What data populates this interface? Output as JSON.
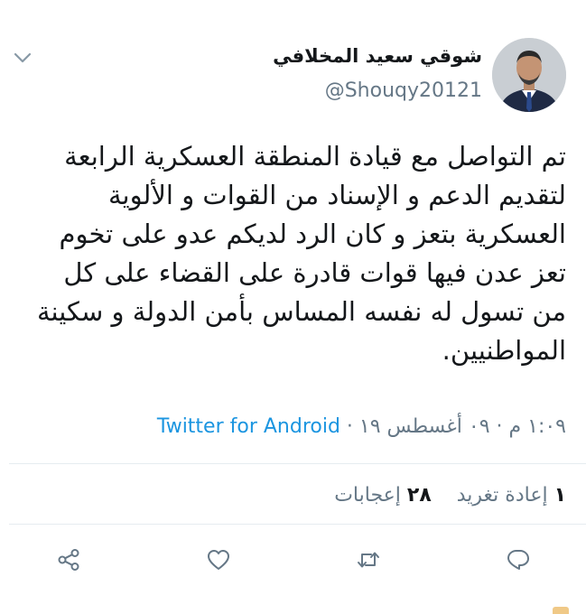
{
  "author": {
    "name": "شوقي سعيد المخلافي",
    "handle": "@Shouqy20121"
  },
  "tweet": {
    "text": "تم التواصل مع قيادة المنطقة العسكرية الرابعة لتقديم الدعم و الإسناد من القوات و الألوية العسكرية بتعز و كان الرد لديكم عدو على تخوم تعز عدن فيها قوات قادرة على القضاء على كل من تسول له نفسه المساس بأمن الدولة و سكينة المواطنيين."
  },
  "meta": {
    "time_date": "١:٠٩ م · ٠٩ أغسطس ١٩ · ",
    "source": "Twitter for Android"
  },
  "stats": {
    "retweet_count": "١",
    "retweet_label": "إعادة تغريد",
    "like_count": "٢٨",
    "like_label": "إعجابات"
  },
  "icons": {
    "reply": "reply-icon",
    "retweet": "retweet-icon",
    "like": "heart-icon",
    "share": "share-icon",
    "more": "chevron-down-icon"
  },
  "colors": {
    "text": "#14171a",
    "secondary": "#657786",
    "link": "#1b95e0",
    "divider": "#e6ecf0"
  }
}
